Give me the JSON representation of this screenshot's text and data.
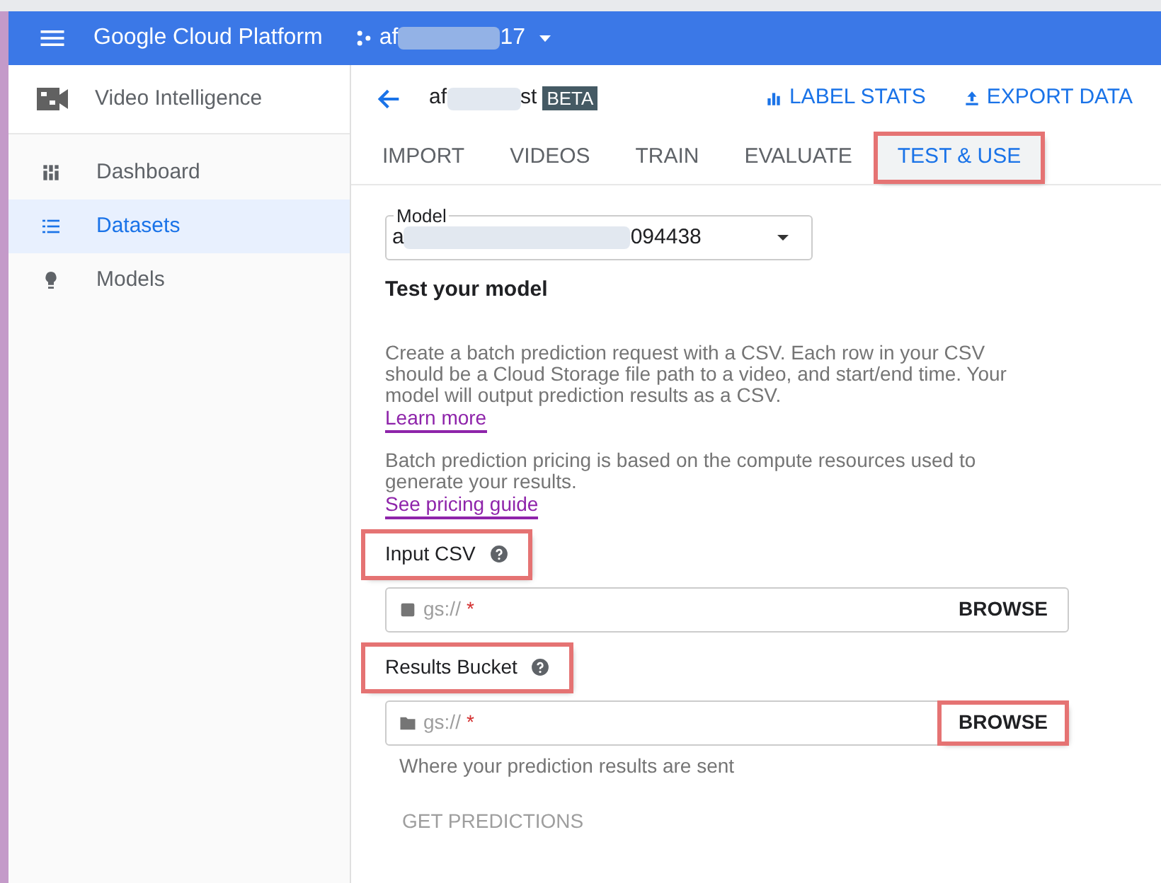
{
  "top_bar": {
    "product": "Google Cloud Platform",
    "project": {
      "visible_start": "af",
      "visible_end": "17"
    }
  },
  "sidebar": {
    "title": "Video Intelligence",
    "items": [
      {
        "label": "Dashboard",
        "kind": "dashboard",
        "selected": false
      },
      {
        "label": "Datasets",
        "kind": "list",
        "selected": true
      },
      {
        "label": "Models",
        "kind": "bulb",
        "selected": false
      }
    ]
  },
  "header": {
    "dataset": {
      "visible_start": "af",
      "visible_end": "st"
    },
    "badge": "BETA",
    "actions": [
      {
        "label": "LABEL STATS",
        "kind": "chart"
      },
      {
        "label": "EXPORT DATA",
        "kind": "upload"
      }
    ]
  },
  "tabs": [
    {
      "label": "IMPORT",
      "selected": false,
      "highlighted": false
    },
    {
      "label": "VIDEOS",
      "selected": false,
      "highlighted": false
    },
    {
      "label": "TRAIN",
      "selected": false,
      "highlighted": false
    },
    {
      "label": "EVALUATE",
      "selected": false,
      "highlighted": false
    },
    {
      "label": "TEST & USE",
      "selected": true,
      "highlighted": true
    }
  ],
  "model_select": {
    "label": "Model",
    "visible_start": "a",
    "visible_end": "094438"
  },
  "heading": "Test your model",
  "description": "Create a batch prediction request with a CSV. Each row in your CSV should be a Cloud Storage file path to a video, and start/end time. Your model will output prediction results as a CSV.",
  "learn_more": "Learn more",
  "pricing_text": "Batch prediction pricing is based on the compute resources used to generate your results.",
  "pricing_link": "See pricing guide",
  "fields": [
    {
      "label": "Input CSV",
      "label_highlighted": true,
      "kind": "file",
      "placeholder": "gs://",
      "required": "*",
      "button": "BROWSE",
      "button_highlighted": false
    },
    {
      "label": "Results Bucket",
      "label_highlighted": true,
      "kind": "folder",
      "placeholder": "gs://",
      "required": "*",
      "button": "BROWSE",
      "button_highlighted": true,
      "hint": "Where your prediction results are sent"
    }
  ],
  "submit": {
    "label": "GET PREDICTIONS",
    "disabled": true
  }
}
